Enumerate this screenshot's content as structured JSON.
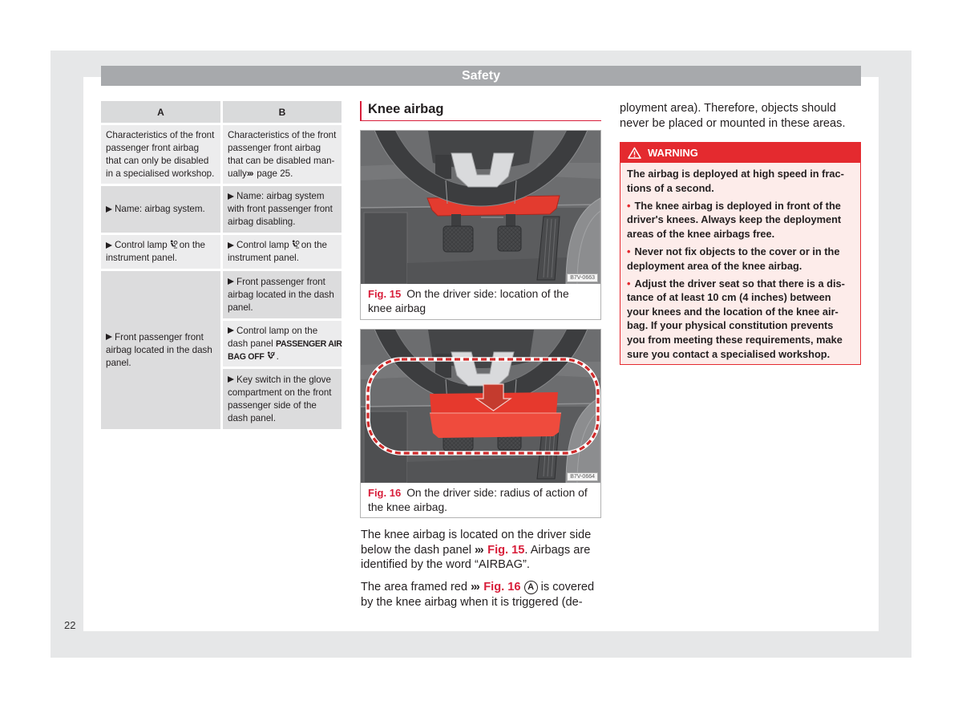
{
  "page": {
    "section_title": "Safety",
    "page_number": "22"
  },
  "theme": {
    "accent_red": "#d81e3a",
    "warning_red": "#e42a2f",
    "header_bar_gray": "#a7a9ac"
  },
  "table": {
    "list_marker_icon": "triangle-right-bullet-icon",
    "headers": [
      "A",
      "B"
    ],
    "rows": [
      {
        "a": {
          "lines": [
            "Characteristics of the front",
            "passenger front airbag",
            "that can only be disabled",
            "in a specialised workshop."
          ]
        },
        "b": {
          "lines": [
            "Characteristics of the front",
            "passenger front airbag",
            "that can be disabled man-"
          ],
          "last_line": {
            "text": "ually",
            "ref_symbol": "›››",
            "ref_text": "page 25."
          }
        }
      },
      {
        "a": {
          "lines": [
            "Name: airbag system."
          ]
        },
        "b": {
          "lines": [
            "Name: airbag system",
            "with front passenger front",
            "airbag disabling."
          ]
        }
      },
      {
        "a": {
          "before_icon": "Control lamp",
          "icon": "airbag-control-lamp-icon",
          "after_icon": "on the",
          "line2": "instrument panel."
        },
        "b": {
          "before_icon": "Control lamp",
          "icon": "airbag-control-lamp-icon",
          "after_icon": "on the",
          "line2": "instrument panel."
        }
      },
      {
        "a": {
          "lines": [
            "Front passenger front",
            "airbag located in the dash",
            "panel."
          ]
        },
        "b": [
          {
            "lines": [
              "Front passenger front",
              "airbag located in the dash",
              "panel."
            ]
          },
          {
            "line1": "Control lamp on the",
            "line2_prefix": "dash panel",
            "label_line1": "PASSENGER AIR",
            "label_line2": "BAG OFF",
            "icon": "passenger-airbag-off-icon",
            "suffix": "."
          },
          {
            "lines": [
              "Key switch in the glove",
              "compartment on the front",
              "passenger side of the",
              "dash panel."
            ]
          }
        ]
      }
    ]
  },
  "section": {
    "heading": "Knee airbag"
  },
  "figures": [
    {
      "label": "Fig. 15",
      "caption_lines": [
        "On the driver side: location of the",
        "knee airbag"
      ],
      "image_code": "B7V-0663"
    },
    {
      "label": "Fig. 16",
      "caption_lines": [
        "On the driver side: radius of action of",
        "the knee airbag."
      ],
      "image_code": "B7V-0664"
    }
  ],
  "body": {
    "p1": {
      "line1": "The knee airbag is located on the driver side",
      "line2_before": "below the dash panel",
      "ref_symbol": "›››",
      "ref_text": "Fig. 15",
      "line2_after": ". Airbags are",
      "line3": "identified by the word “AIRBAG”."
    },
    "p2": {
      "line1_before": "The area framed red",
      "ref_symbol": "›››",
      "ref_text": "Fig. 16",
      "callout": "A",
      "line1_after": "is covered",
      "line2": "by the knee airbag when it is triggered (de-"
    },
    "continued": [
      "ployment area). Therefore, objects should",
      "never be placed or mounted in these areas."
    ]
  },
  "warning": {
    "icon": "warning-triangle-icon",
    "title": "WARNING",
    "bullet": "•",
    "intro": [
      "The airbag is deployed at high speed in frac-",
      "tions of a second."
    ],
    "bullets": [
      [
        "The knee airbag is deployed in front of the",
        "driver's knees. Always keep the deployment",
        "areas of the knee airbags free."
      ],
      [
        "Never not fix objects to the cover or in the",
        "deployment area of the knee airbag."
      ],
      [
        "Adjust the driver seat so that there is a dis-",
        "tance of at least 10 cm (4 inches) between",
        "your knees and the location of the knee air-",
        "bag. If your physical constitution prevents",
        "you from meeting these requirements, make",
        "sure you contact a specialised workshop."
      ]
    ]
  }
}
